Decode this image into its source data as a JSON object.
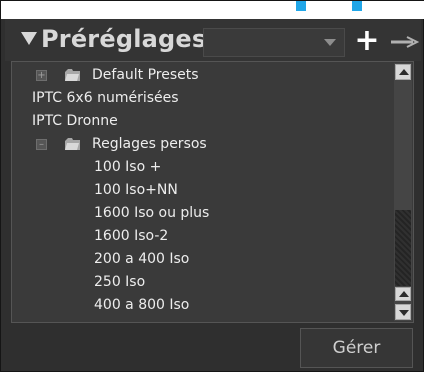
{
  "panel": {
    "title": "Préréglages",
    "manage_button": "Gérer",
    "preset_select": {
      "value": ""
    }
  },
  "icons": {
    "expand": "plus-box-icon",
    "collapse": "minus-box-icon",
    "folder": "folder-icon",
    "add": "plus-icon",
    "remove": "minus-icon"
  },
  "tree": {
    "rows": [
      {
        "label": "Default Presets",
        "type": "folder",
        "expanded": false
      },
      {
        "label": "IPTC 6x6 numérisées",
        "type": "preset"
      },
      {
        "label": "IPTC Dronne",
        "type": "preset"
      },
      {
        "label": "Reglages persos",
        "type": "folder",
        "expanded": true
      },
      {
        "label": "100 Iso +",
        "type": "preset"
      },
      {
        "label": "100 Iso+NN",
        "type": "preset"
      },
      {
        "label": "1600 Iso ou plus",
        "type": "preset"
      },
      {
        "label": "1600 Iso-2",
        "type": "preset"
      },
      {
        "label": "200 a 400 Iso",
        "type": "preset"
      },
      {
        "label": "250 Iso",
        "type": "preset"
      },
      {
        "label": "400 a 800 Iso",
        "type": "preset"
      }
    ]
  },
  "colors": {
    "accent": "#20a6e8",
    "panel": "#343434",
    "list": "#3a3a3a",
    "text": "#ededed"
  }
}
